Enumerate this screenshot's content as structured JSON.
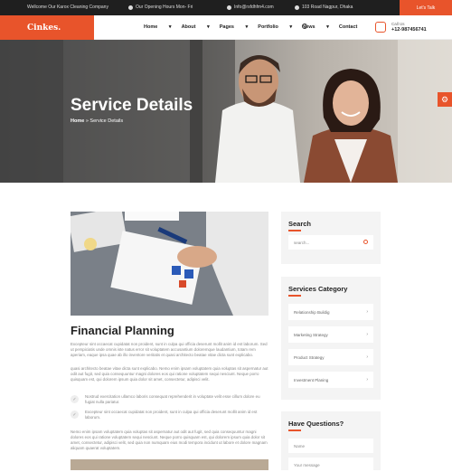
{
  "topbar": {
    "welcome": "Wellcome Our Karox Cleaning Company",
    "hours": "Our Opening Hours Mon- Fri",
    "email": "Info@rsfdhfm4.com",
    "address": "103 Road Nagpur, Dhaka",
    "cta": "Let's Talk"
  },
  "brand": {
    "logo": "Cinkes."
  },
  "nav": {
    "items": [
      "Home",
      "About",
      "Pages",
      "Portfolio",
      "News",
      "Contact"
    ],
    "has_dropdown": [
      true,
      true,
      true,
      true,
      true,
      false
    ]
  },
  "call": {
    "label": "Call Us",
    "number": "+12-987456741"
  },
  "hero": {
    "title": "Service Details",
    "crumb_home": "Home",
    "crumb_sep": "»",
    "crumb_current": "Service Details"
  },
  "main": {
    "heading": "Financial Planning",
    "para1": "Excepteur sint occaecat cupidatat non proident, sunt in culpa qui officia deserunt mollit anim id est laborum. Sed ut perspiciatis unde omnis iste natus error sit voluptatem accusantium doloremque laudantium, totam rem aperiam, eaque ipsa quae ab illo inventore veritatis et quasi architecto beatae vitae dicta sunt explicabo.",
    "para2": "quasi architecto beatae vitae dicta sunt explicabo. Nemo enim ipsam voluptatem quia voluptas sit aspernatur aut odit aut fugit, sed quia consequuntur magni dolores eos qui ratione voluptatem sequi nesciunt. Neque porro quisquam est, qui dolorem ipsum quia dolor sit amet, consectetur, adipisci velit.",
    "check1": "Nostrud exercitation ullamco laboris consequat reprehenderit in voluptate velit esse cillum dolore eu fugiat nulla pariatur.",
    "check2": "Excepteur sint occaecat cupidatat non proident, sunt in culpa qui officia deserunt mollit anim id est laborum.",
    "para3": "Nemo enim ipsam voluptatem quia voluptas sit aspernatur aut odit aut fugit, sed quia consequuntur magni dolores eos qui ratione voluptatem sequi nesciunt. Neque porro quisquam est, qui dolorem ipsum quia dolor sit amet, consectetur, adipisci velit, sed quia non numquam eius modi tempora incidunt ut labore et dolore magnam aliquam quaerat voluptatem."
  },
  "sidebar": {
    "search_title": "Search",
    "search_placeholder": "search...",
    "category_title": "Services Category",
    "categories": [
      "Relationship Buildig",
      "Marketing Strategy",
      "Product Strategy",
      "Investment Planing"
    ],
    "questions_title": "Have Questions?",
    "name_placeholder": "Name",
    "message_placeholder": "Your message"
  },
  "colors": {
    "accent": "#e8542b",
    "topbar": "#1f1f1f"
  },
  "icons": [
    "home-icon",
    "clock-icon",
    "mail-icon",
    "location-icon",
    "phone-icon",
    "search-icon",
    "gear-icon",
    "check-icon",
    "chevron-right-icon"
  ]
}
